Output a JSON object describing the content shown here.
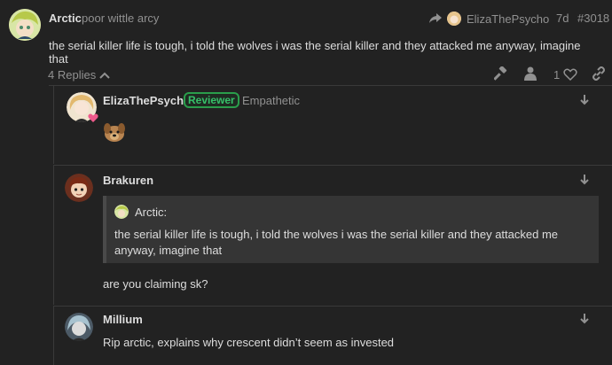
{
  "post": {
    "author": "Arctic",
    "user_title": "poor wittle arcy",
    "reply_to_user": "ElizaThePsycho",
    "age": "7d",
    "post_number": "#3018",
    "body": "the serial killer life is tough, i told the wolves i was the serial killer and they attacked me anyway, imagine that",
    "replies_toggle": "4 Replies",
    "like_count": "1"
  },
  "replies": [
    {
      "author": "ElizaThePsycho",
      "flair": "Reviewer",
      "user_title": "Empathetic"
    },
    {
      "author": "Brakuren",
      "quote_author": "Arctic:",
      "quote_text": "the serial killer life is tough, i told the wolves i was the serial killer and they attacked me anyway, imagine that",
      "body": "are you claiming sk?"
    },
    {
      "author": "Millium",
      "body": "Rip arctic, explains why crescent didn’t seem as invested"
    }
  ],
  "colors": {
    "background": "#222222",
    "text": "#dddddd",
    "muted": "#919191",
    "reviewer_green": "#36c069"
  }
}
